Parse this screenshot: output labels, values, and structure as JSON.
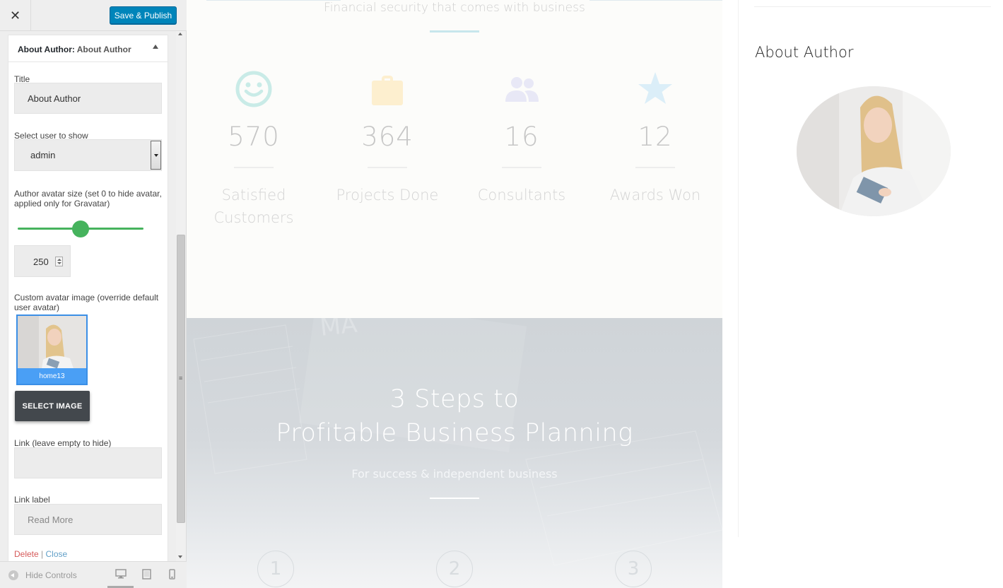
{
  "sidebar": {
    "close_label": "✕",
    "publish_label": "Save & Publish",
    "widget": {
      "title_prefix": "About Author:",
      "title_name": "About Author",
      "fields": {
        "title_label": "Title",
        "title_value": "About Author",
        "user_label": "Select user to show",
        "user_value": "admin",
        "avatar_size_label": "Author avatar size (set 0 to hide avatar, applied only for Gravatar)",
        "avatar_size_value": "250",
        "avatar_size_slider_fraction": 0.5,
        "custom_avatar_label": "Custom avatar image (override default user avatar)",
        "image_caption": "home13",
        "select_image_label": "SELECT IMAGE",
        "link_label": "Link (leave empty to hide)",
        "link_value": "",
        "link_text_label": "Link label",
        "link_text_value": "Read More"
      },
      "delete_label": "Delete",
      "separator": "|",
      "close_link_label": "Close"
    },
    "footer": {
      "hide_controls_label": "Hide Controls"
    }
  },
  "preview": {
    "tagline": "Financial security that comes with business",
    "stats": [
      {
        "icon": "smiley-icon",
        "value": "570",
        "label": "Satisfied Customers",
        "color": "#c9ebe7"
      },
      {
        "icon": "briefcase-icon",
        "value": "364",
        "label": "Projects Done",
        "color": "#fdefcf"
      },
      {
        "icon": "users-icon",
        "value": "16",
        "label": "Consultants",
        "color": "#e8e8f6"
      },
      {
        "icon": "star-icon",
        "value": "12",
        "label": "Awards Won",
        "color": "#dbeef8"
      }
    ],
    "hero": {
      "title_line1": "3 Steps to",
      "title_line2": "Profitable Business Planning",
      "subtitle": "For success & independent business",
      "steps": [
        "1",
        "2",
        "3"
      ]
    },
    "sidebar_widget": {
      "title": "About Author"
    }
  },
  "colors": {
    "accent": "#0085ba",
    "slider": "#46b35d",
    "delete": "#d65a5a",
    "close_link": "#62a0c8"
  }
}
